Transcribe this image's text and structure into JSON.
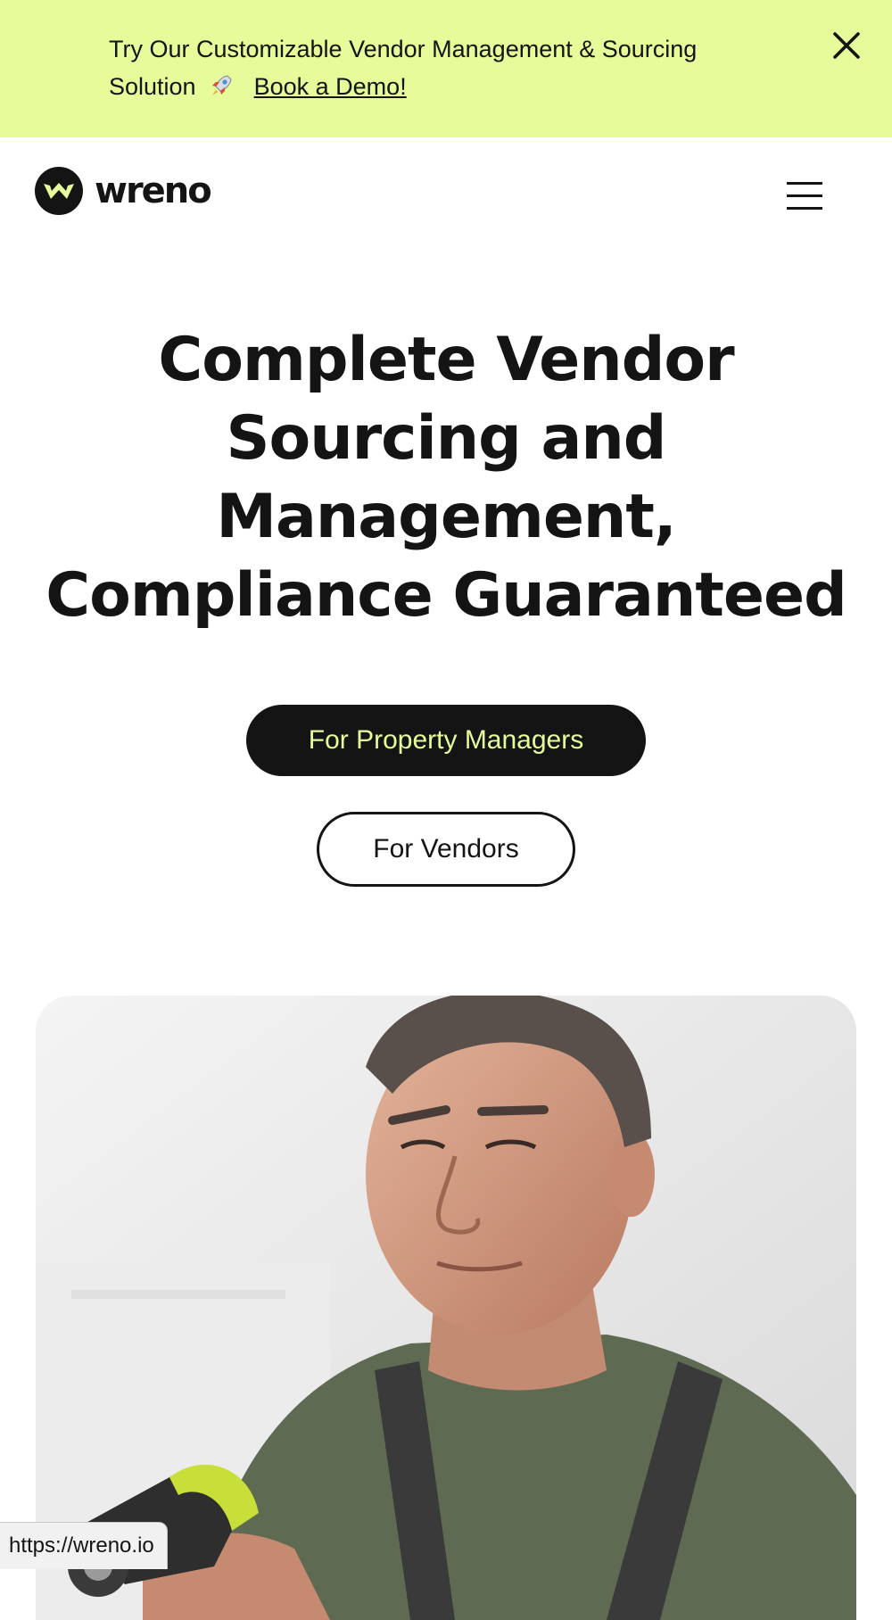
{
  "banner": {
    "text": "Try Our Customizable Vendor Management & Sourcing Solution",
    "link_label": "Book a Demo!",
    "rocket_icon": "rocket-icon",
    "close_icon": "close-icon",
    "background": "#e6fb9a"
  },
  "header": {
    "logo_text": "wreno",
    "logo_icon": "wreno-logo-icon",
    "menu_icon": "hamburger-menu-icon"
  },
  "hero": {
    "title": "Complete Vendor Sourcing and Management, Compliance Guaranteed",
    "primary_button": "For Property Managers",
    "secondary_button": "For Vendors",
    "accent_color": "#e6fb9a",
    "dark_color": "#141414"
  },
  "status_bar": {
    "url": "https://wreno.io"
  }
}
